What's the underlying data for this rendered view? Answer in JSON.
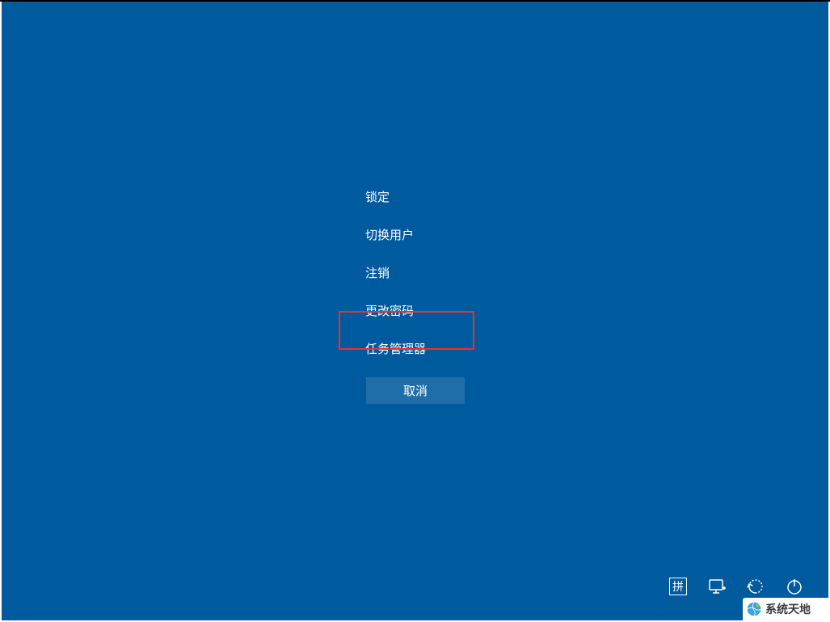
{
  "menu": {
    "items": [
      {
        "label": "锁定"
      },
      {
        "label": "切换用户"
      },
      {
        "label": "注销"
      },
      {
        "label": "更改密码"
      },
      {
        "label": "任务管理器"
      }
    ],
    "cancel": "取消"
  },
  "tray": {
    "ime": "拼",
    "icons": [
      "ime-icon",
      "network-icon",
      "ease-of-access-icon",
      "power-icon"
    ]
  },
  "watermark": "系统天地",
  "highlight": {
    "target_index": 4
  },
  "colors": {
    "background": "#005a9e",
    "highlight_border": "#e8322b",
    "cancel_button": "#1f6eaa",
    "text": "#ffffff"
  }
}
